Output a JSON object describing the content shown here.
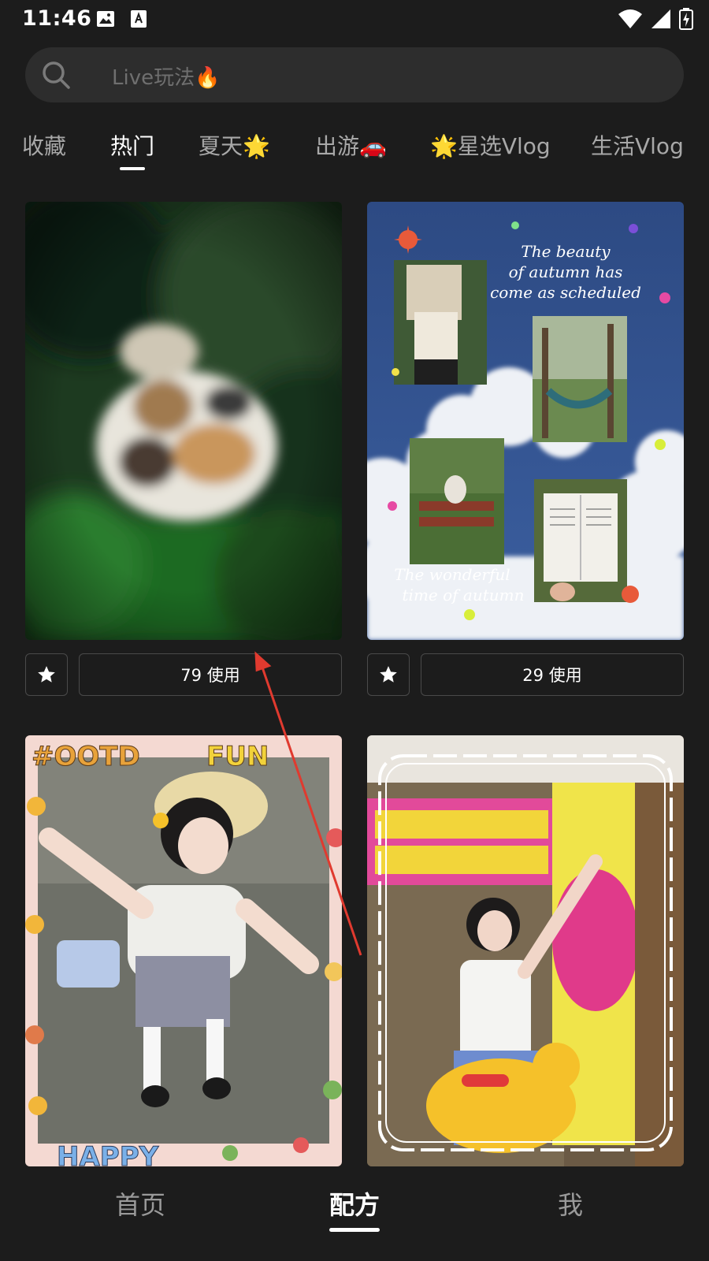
{
  "status_bar": {
    "time": "11:46"
  },
  "search": {
    "placeholder": "Live玩法🔥"
  },
  "tabs": [
    {
      "label": "收藏"
    },
    {
      "label": "热门",
      "active": true
    },
    {
      "label": "夏天🌟"
    },
    {
      "label": "出游🚗"
    },
    {
      "label": "🌟星选Vlog"
    },
    {
      "label": "生活Vlog"
    }
  ],
  "cards": [
    {
      "usage": "79 使用"
    },
    {
      "usage": "29 使用",
      "overlay_text": {
        "line1": "The beauty",
        "line2": "of autumn has",
        "line3": "come as scheduled",
        "line4": "The wonderful",
        "line5": "time of autumn"
      }
    },
    {
      "sticker_text": {
        "top_left": "#OOTD",
        "top_right": "FUN",
        "bottom": "HAPPY"
      }
    },
    {}
  ],
  "bottom_nav": [
    {
      "label": "首页"
    },
    {
      "label": "配方",
      "active": true
    },
    {
      "label": "我"
    }
  ],
  "colors": {
    "background": "#1c1c1c",
    "search_bg": "#2d2d2d",
    "annotation_arrow": "#e03a2f"
  }
}
